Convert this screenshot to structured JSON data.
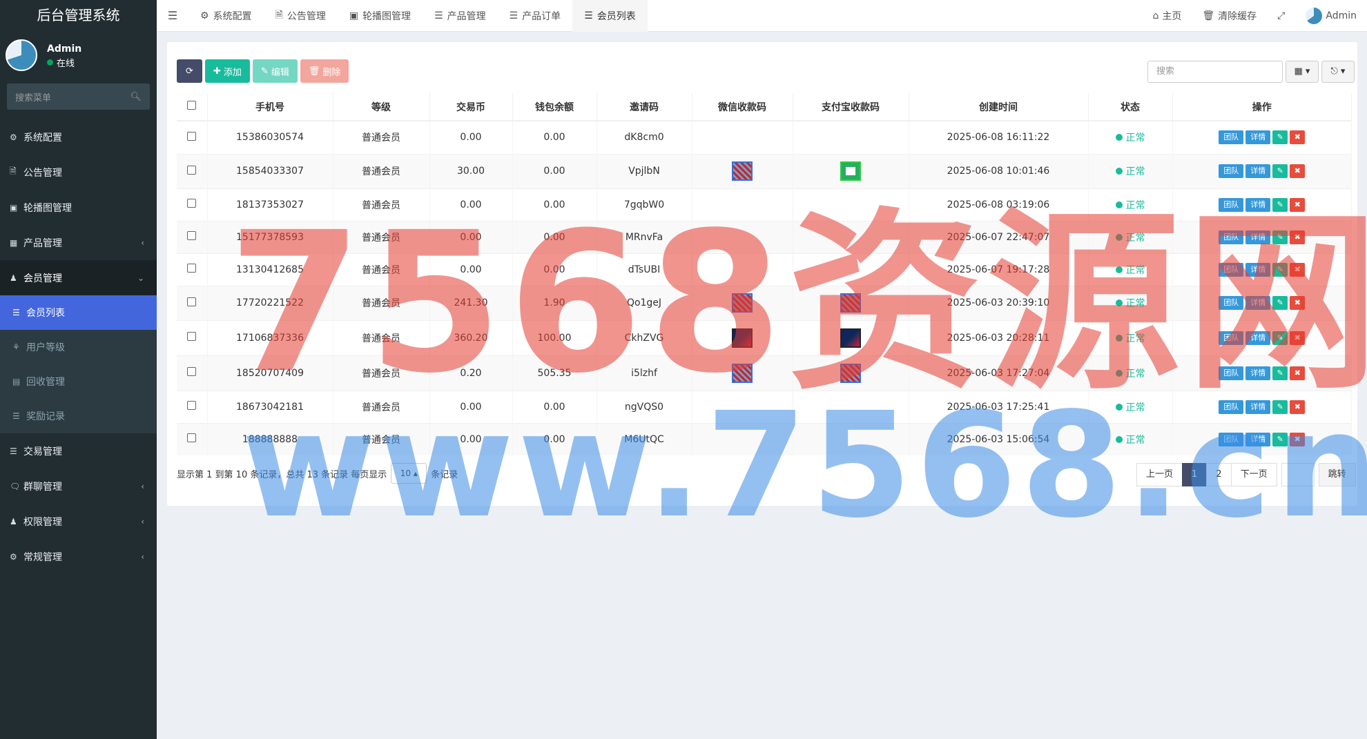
{
  "app_title": "后台管理系统",
  "user": {
    "name": "Admin",
    "status": "在线"
  },
  "sidebar": {
    "search_placeholder": "搜索菜单",
    "items": [
      {
        "label": "系统配置",
        "icon": "gear-icon"
      },
      {
        "label": "公告管理",
        "icon": "file-icon"
      },
      {
        "label": "轮播图管理",
        "icon": "image-icon"
      },
      {
        "label": "产品管理",
        "icon": "grid-icon"
      },
      {
        "label": "会员管理",
        "icon": "user-icon"
      },
      {
        "label": "交易管理",
        "icon": "list-icon"
      },
      {
        "label": "群聊管理",
        "icon": "comments-icon"
      },
      {
        "label": "权限管理",
        "icon": "group-icon"
      },
      {
        "label": "常规管理",
        "icon": "cogs-icon"
      }
    ],
    "sub_items": [
      {
        "label": "会员列表",
        "icon": "list-icon"
      },
      {
        "label": "用户等级",
        "icon": "sitemap-icon"
      },
      {
        "label": "回收管理",
        "icon": "card-icon"
      },
      {
        "label": "奖励记录",
        "icon": "list-icon"
      }
    ]
  },
  "topnav": {
    "tabs": [
      "系统配置",
      "公告管理",
      "轮播图管理",
      "产品管理",
      "产品订单",
      "会员列表"
    ],
    "home": "主页",
    "clear_cache": "清除缓存",
    "admin": "Admin"
  },
  "toolbar": {
    "add": "添加",
    "edit": "编辑",
    "delete": "删除",
    "search_placeholder": "搜索"
  },
  "table": {
    "headers": [
      "手机号",
      "等级",
      "交易币",
      "钱包余额",
      "邀请码",
      "微信收款码",
      "支付宝收款码",
      "创建时间",
      "状态",
      "操作"
    ],
    "op_team": "团队",
    "op_detail": "详情",
    "rows": [
      {
        "phone": "15386030574",
        "level": "普通会员",
        "coin": "0.00",
        "balance": "0.00",
        "code": "dK8cm0",
        "wx": "",
        "ali": "",
        "time": "2025-06-08 16:11:22",
        "status": "正常"
      },
      {
        "phone": "15854033307",
        "level": "普通会员",
        "coin": "30.00",
        "balance": "0.00",
        "code": "VpjlbN",
        "wx": "qr",
        "ali": "qr-green",
        "time": "2025-06-08 10:01:46",
        "status": "正常"
      },
      {
        "phone": "18137353027",
        "level": "普通会员",
        "coin": "0.00",
        "balance": "0.00",
        "code": "7gqbW0",
        "wx": "",
        "ali": "",
        "time": "2025-06-08 03:19:06",
        "status": "正常"
      },
      {
        "phone": "15177378593",
        "level": "普通会员",
        "coin": "0.00",
        "balance": "0.00",
        "code": "MRnvFa",
        "wx": "",
        "ali": "",
        "time": "2025-06-07 22:47:07",
        "status": "正常"
      },
      {
        "phone": "13130412685",
        "level": "普通会员",
        "coin": "0.00",
        "balance": "0.00",
        "code": "dTsUBI",
        "wx": "",
        "ali": "",
        "time": "2025-06-07 19:17:28",
        "status": "正常"
      },
      {
        "phone": "17720221522",
        "level": "普通会员",
        "coin": "241.30",
        "balance": "1.90",
        "code": "Qo1geJ",
        "wx": "qr",
        "ali": "qr",
        "time": "2025-06-03 20:39:10",
        "status": "正常"
      },
      {
        "phone": "17106837336",
        "level": "普通会员",
        "coin": "360.20",
        "balance": "100.00",
        "code": "CkhZVG",
        "wx": "qr-dark",
        "ali": "qr-dark",
        "time": "2025-06-03 20:28:11",
        "status": "正常"
      },
      {
        "phone": "18520707409",
        "level": "普通会员",
        "coin": "0.20",
        "balance": "505.35",
        "code": "i5lzhf",
        "wx": "qr",
        "ali": "qr",
        "time": "2025-06-03 17:27:04",
        "status": "正常"
      },
      {
        "phone": "18673042181",
        "level": "普通会员",
        "coin": "0.00",
        "balance": "0.00",
        "code": "ngVQS0",
        "wx": "",
        "ali": "",
        "time": "2025-06-03 17:25:41",
        "status": "正常"
      },
      {
        "phone": "188888888",
        "level": "普通会员",
        "coin": "0.00",
        "balance": "0.00",
        "code": "M6UtQC",
        "wx": "",
        "ali": "",
        "time": "2025-06-03 15:06:54",
        "status": "正常"
      }
    ]
  },
  "footer": {
    "info": "显示第 1 到第 10 条记录，总共 13 条记录 每页显示",
    "page_size": "10",
    "suffix": "条记录",
    "prev": "上一页",
    "pages": [
      "1",
      "2"
    ],
    "next": "下一页",
    "jump": "跳转"
  },
  "watermark": {
    "line1": "7568资源网",
    "line2": "www.7568.cn"
  },
  "colors": {
    "sidebar_bg": "#222d32",
    "active_blue": "#4466dd",
    "green": "#18bc9c",
    "primary": "#444c69"
  }
}
